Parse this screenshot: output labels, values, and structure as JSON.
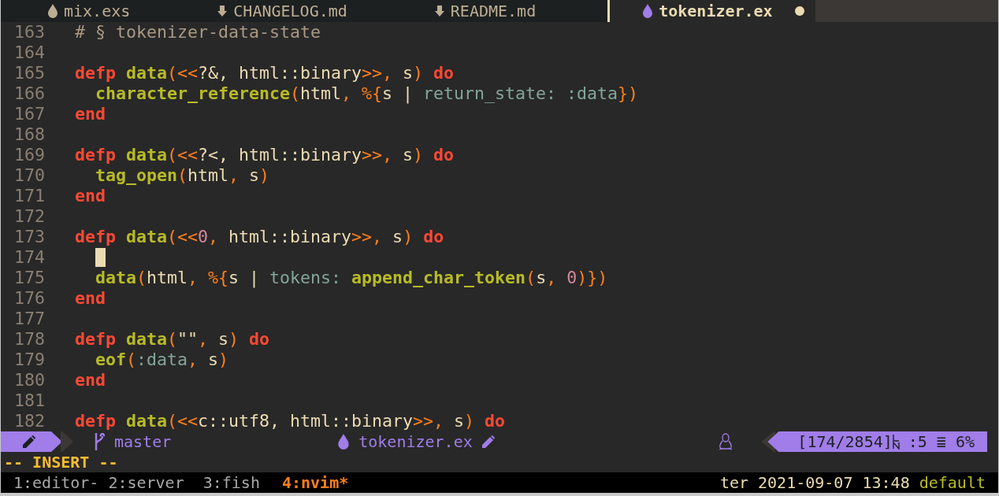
{
  "tabs": [
    {
      "label": "mix.exs",
      "kind": "elixir",
      "selected": false,
      "modified": false
    },
    {
      "label": "CHANGELOG.md",
      "kind": "markdown",
      "selected": false,
      "modified": false
    },
    {
      "label": "README.md",
      "kind": "markdown",
      "selected": false,
      "modified": false
    },
    {
      "label": "tokenizer.ex",
      "kind": "elixir",
      "selected": true,
      "modified": true
    }
  ],
  "lines": [
    {
      "number": "163",
      "tokens": [
        {
          "kind": "comment",
          "text": "# § tokenizer-data-state"
        }
      ]
    },
    {
      "number": "164"
    },
    {
      "number": "165",
      "tokens": [
        {
          "kind": "keyword",
          "text": "defp "
        },
        {
          "kind": "function",
          "text": "data"
        },
        {
          "kind": "punct",
          "text": "(<<"
        },
        {
          "kind": "plain",
          "text": "?&, html::binary"
        },
        {
          "kind": "punct",
          "text": ">>,"
        },
        {
          "kind": "plain",
          "text": " s"
        },
        {
          "kind": "punct",
          "text": ")"
        },
        {
          "kind": "keyword",
          "text": " do"
        }
      ]
    },
    {
      "number": "166",
      "indented": true,
      "tokens": [
        {
          "kind": "function",
          "text": "character_reference"
        },
        {
          "kind": "punct",
          "text": "("
        },
        {
          "kind": "plain",
          "text": "html"
        },
        {
          "kind": "punct",
          "text": ", %{"
        },
        {
          "kind": "plain",
          "text": "s | "
        },
        {
          "kind": "atom",
          "text": "return_state: :data"
        },
        {
          "kind": "punct",
          "text": "})"
        }
      ]
    },
    {
      "number": "167",
      "tokens": [
        {
          "kind": "keyword",
          "text": "end"
        }
      ]
    },
    {
      "number": "168"
    },
    {
      "number": "169",
      "tokens": [
        {
          "kind": "keyword",
          "text": "defp "
        },
        {
          "kind": "function",
          "text": "data"
        },
        {
          "kind": "punct",
          "text": "(<<"
        },
        {
          "kind": "plain",
          "text": "?<, html::binary"
        },
        {
          "kind": "punct",
          "text": ">>,"
        },
        {
          "kind": "plain",
          "text": " s"
        },
        {
          "kind": "punct",
          "text": ")"
        },
        {
          "kind": "keyword",
          "text": " do"
        }
      ]
    },
    {
      "number": "170",
      "indented": true,
      "tokens": [
        {
          "kind": "function",
          "text": "tag_open"
        },
        {
          "kind": "punct",
          "text": "("
        },
        {
          "kind": "plain",
          "text": "html"
        },
        {
          "kind": "punct",
          "text": ","
        },
        {
          "kind": "plain",
          "text": " s"
        },
        {
          "kind": "punct",
          "text": ")"
        }
      ]
    },
    {
      "number": "171",
      "tokens": [
        {
          "kind": "keyword",
          "text": "end"
        }
      ]
    },
    {
      "number": "172"
    },
    {
      "number": "173",
      "tokens": [
        {
          "kind": "keyword",
          "text": "defp "
        },
        {
          "kind": "function",
          "text": "data"
        },
        {
          "kind": "punct",
          "text": "(<<"
        },
        {
          "kind": "number",
          "text": "0"
        },
        {
          "kind": "punct",
          "text": ","
        },
        {
          "kind": "plain",
          "text": " html::binary"
        },
        {
          "kind": "punct",
          "text": ">>,"
        },
        {
          "kind": "plain",
          "text": " s"
        },
        {
          "kind": "punct",
          "text": ")"
        },
        {
          "kind": "keyword",
          "text": " do"
        }
      ]
    },
    {
      "number": "174",
      "indented": true,
      "cursor": true
    },
    {
      "number": "175",
      "indented": true,
      "tokens": [
        {
          "kind": "function",
          "text": "data"
        },
        {
          "kind": "punct",
          "text": "("
        },
        {
          "kind": "plain",
          "text": "html"
        },
        {
          "kind": "punct",
          "text": ", %{"
        },
        {
          "kind": "plain",
          "text": "s | "
        },
        {
          "kind": "atom",
          "text": "tokens: "
        },
        {
          "kind": "function",
          "text": "append_char_token"
        },
        {
          "kind": "punct",
          "text": "("
        },
        {
          "kind": "plain",
          "text": "s"
        },
        {
          "kind": "punct",
          "text": ", "
        },
        {
          "kind": "number",
          "text": "0"
        },
        {
          "kind": "punct",
          "text": ")})"
        }
      ]
    },
    {
      "number": "176",
      "tokens": [
        {
          "kind": "keyword",
          "text": "end"
        }
      ]
    },
    {
      "number": "177"
    },
    {
      "number": "178",
      "tokens": [
        {
          "kind": "keyword",
          "text": "defp "
        },
        {
          "kind": "function",
          "text": "data"
        },
        {
          "kind": "punct",
          "text": "("
        },
        {
          "kind": "plain",
          "text": "\"\""
        },
        {
          "kind": "punct",
          "text": ", "
        },
        {
          "kind": "plain",
          "text": "s"
        },
        {
          "kind": "punct",
          "text": ")"
        },
        {
          "kind": "keyword",
          "text": " do"
        }
      ]
    },
    {
      "number": "179",
      "indented": true,
      "tokens": [
        {
          "kind": "function",
          "text": "eof"
        },
        {
          "kind": "punct",
          "text": "("
        },
        {
          "kind": "atom",
          "text": ":data"
        },
        {
          "kind": "punct",
          "text": ", "
        },
        {
          "kind": "plain",
          "text": "s"
        },
        {
          "kind": "punct",
          "text": ")"
        }
      ]
    },
    {
      "number": "180",
      "tokens": [
        {
          "kind": "keyword",
          "text": "end"
        }
      ]
    },
    {
      "number": "181"
    },
    {
      "number": "182",
      "tokens": [
        {
          "kind": "keyword",
          "text": "defp "
        },
        {
          "kind": "function",
          "text": "data"
        },
        {
          "kind": "punct",
          "text": "(<<"
        },
        {
          "kind": "plain",
          "text": "c::utf8, html::binary"
        },
        {
          "kind": "punct",
          "text": ">>,"
        },
        {
          "kind": "plain",
          "text": " s"
        },
        {
          "kind": "punct",
          "text": ")"
        },
        {
          "kind": "keyword",
          "text": " do"
        }
      ]
    }
  ],
  "status_line": {
    "branch": "master",
    "file": "tokenizer.ex",
    "position": "[174/2854]",
    "column": ":5",
    "lines_glyph": "≣",
    "percent": "6%"
  },
  "mode": "-- INSERT --",
  "tmux": {
    "windows": [
      {
        "label": "1:editor-",
        "selected": false
      },
      {
        "label": "2:server",
        "selected": false
      },
      {
        "label": "3:fish",
        "selected": false
      },
      {
        "label": "4:nvim*",
        "selected": true
      }
    ],
    "clock": "ter 2021-09-07 13:48",
    "session": "default"
  }
}
